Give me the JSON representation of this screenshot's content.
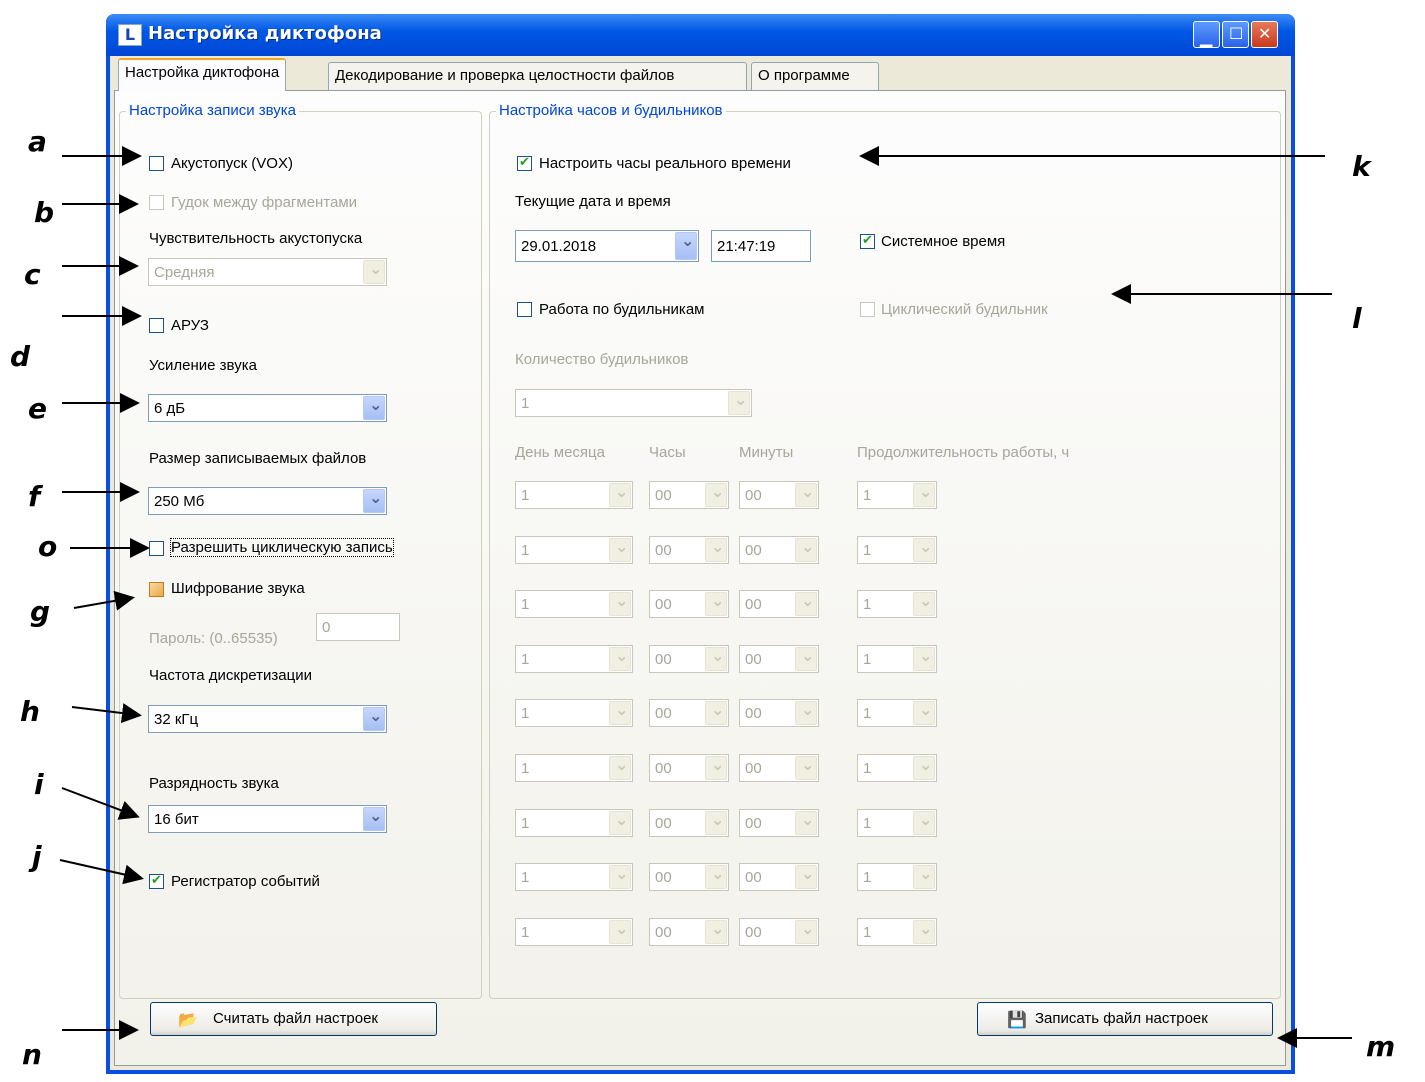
{
  "window": {
    "title": "Настройка диктофона",
    "app_icon": "L"
  },
  "tabs": [
    {
      "label": "Настройка диктофона"
    },
    {
      "label": "Декодирование и проверка целостности файлов"
    },
    {
      "label": "О программе"
    }
  ],
  "left": {
    "group_title": "Настройка записи звука",
    "vox_label": "Акустопуск (VOX)",
    "beep_label": "Гудок между фрагментами",
    "sens_label": "Чувствительность акустопуска",
    "sens_value": "Средняя",
    "agc_label": "АРУЗ",
    "gain_label": "Усиление звука",
    "gain_value": "6 дБ",
    "filesize_label": "Размер записываемых файлов",
    "filesize_value": "250 Мб",
    "cyclic_label": "Разрешить циклическую запись",
    "encrypt_label": "Шифрование звука",
    "password_label": "Пароль: (0..65535)",
    "password_value": "0",
    "rate_label": "Частота дискретизации",
    "rate_value": "32 кГц",
    "bits_label": "Разрядность звука",
    "bits_value": "16 бит",
    "events_label": "Регистратор событий"
  },
  "right": {
    "group_title": "Настройка часов и будильников",
    "rtc_label": "Настроить часы реального времени",
    "datetime_label": "Текущие дата и время",
    "date_value": "29.01.2018",
    "time_value": "21:47:19",
    "system_time_label": "Системное время",
    "alarms_label": "Работа по будильникам",
    "cyclic_alarm_label": "Циклический будильник",
    "alarm_count_label": "Количество будильников",
    "alarm_count_value": "1",
    "col_day": "День месяца",
    "col_hours": "Часы",
    "col_minutes": "Минуты",
    "col_duration": "Продолжительность работы, ч",
    "alarm_rows": [
      {
        "day": "1",
        "hour": "00",
        "minute": "00",
        "duration": "1"
      },
      {
        "day": "1",
        "hour": "00",
        "minute": "00",
        "duration": "1"
      },
      {
        "day": "1",
        "hour": "00",
        "minute": "00",
        "duration": "1"
      },
      {
        "day": "1",
        "hour": "00",
        "minute": "00",
        "duration": "1"
      },
      {
        "day": "1",
        "hour": "00",
        "minute": "00",
        "duration": "1"
      },
      {
        "day": "1",
        "hour": "00",
        "minute": "00",
        "duration": "1"
      },
      {
        "day": "1",
        "hour": "00",
        "minute": "00",
        "duration": "1"
      },
      {
        "day": "1",
        "hour": "00",
        "minute": "00",
        "duration": "1"
      },
      {
        "day": "1",
        "hour": "00",
        "minute": "00",
        "duration": "1"
      }
    ]
  },
  "buttons": {
    "read_label": "Считать файл настроек",
    "write_label": "Записать файл настроек",
    "read_icon": "folder-open-icon",
    "write_icon": "floppy-disk-icon"
  },
  "annotations": {
    "a": "a",
    "b": "b",
    "c": "c",
    "d": "d",
    "e": "e",
    "f": "f",
    "o": "o",
    "g": "g",
    "h": "h",
    "i": "i",
    "j": "j",
    "k": "k",
    "l": "l",
    "m": "m",
    "n": "n"
  }
}
